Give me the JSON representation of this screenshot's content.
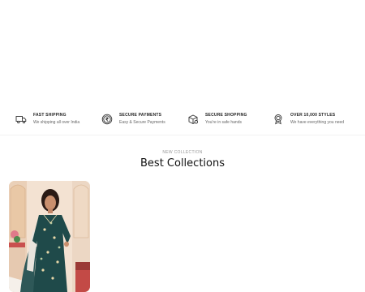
{
  "features": [
    {
      "icon": "truck-icon",
      "title": "FAST SHIPPING",
      "subtitle": "We shipping all over India"
    },
    {
      "icon": "rupee-coin-icon",
      "title": "SECURE PAYMENTS",
      "subtitle": "Easy & Secure Payments"
    },
    {
      "icon": "package-icon",
      "title": "SECURE SHOPPING",
      "subtitle": "You're in safe hands"
    },
    {
      "icon": "award-badge-icon",
      "title": "OVER 10,000 STYLES",
      "subtitle": "We have everything you need"
    }
  ],
  "collection": {
    "eyebrow": "NEW COLLECTION",
    "title": "Best Collections"
  },
  "colors": {
    "product_fabric": "#1f4a4a",
    "background_accent": "#f4e3d3"
  }
}
